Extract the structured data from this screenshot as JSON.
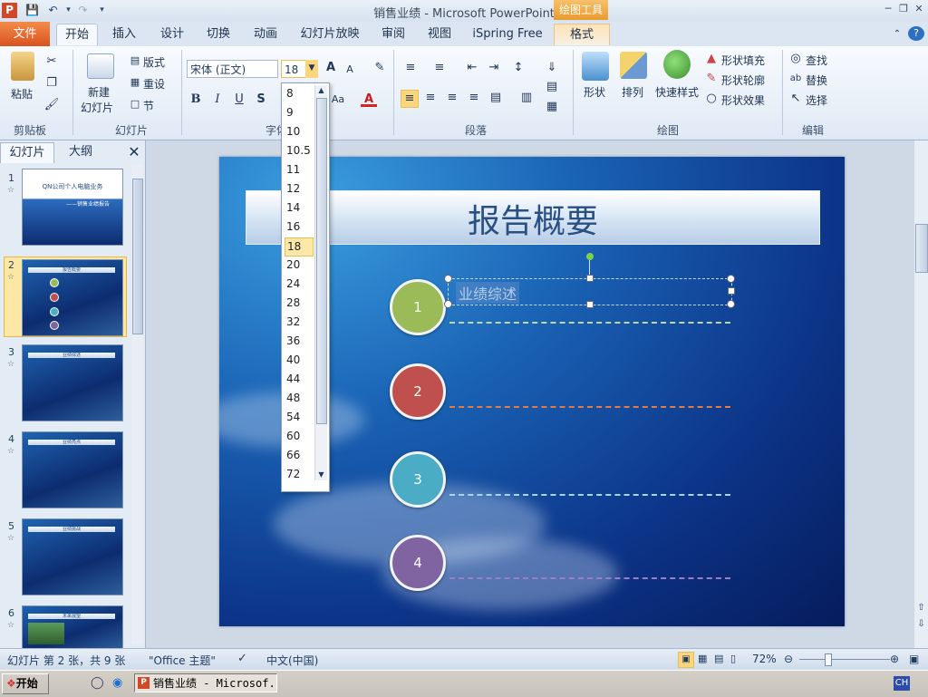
{
  "window": {
    "title": "销售业绩 - Microsoft PowerPoint",
    "context_tab_title": "绘图工具"
  },
  "tabs": [
    {
      "label": "文件"
    },
    {
      "label": "开始"
    },
    {
      "label": "插入"
    },
    {
      "label": "设计"
    },
    {
      "label": "切换"
    },
    {
      "label": "动画"
    },
    {
      "label": "幻灯片放映"
    },
    {
      "label": "审阅"
    },
    {
      "label": "视图"
    },
    {
      "label": "iSpring Free"
    },
    {
      "label": "格式"
    }
  ],
  "ribbon": {
    "clipboard": {
      "label": "剪贴板",
      "paste": "粘贴"
    },
    "slides": {
      "label": "幻灯片",
      "new_slide_1": "新建",
      "new_slide_2": "幻灯片",
      "layout": "版式",
      "reset": "重设",
      "section": "节"
    },
    "font": {
      "label": "字体",
      "font_name": "宋体 (正文)",
      "font_size": "18",
      "bold": "B",
      "italic": "I",
      "underline": "U",
      "shadow": "S"
    },
    "paragraph": {
      "label": "段落"
    },
    "drawing": {
      "label": "绘图",
      "shapes": "形状",
      "arrange": "排列",
      "quick_styles": "快速样式",
      "shape_fill": "形状填充",
      "shape_outline": "形状轮廓",
      "shape_effects": "形状效果"
    },
    "editing": {
      "label": "编辑",
      "find": "查找",
      "replace": "替换",
      "select": "选择"
    }
  },
  "font_size_options": [
    "8",
    "9",
    "10",
    "10.5",
    "11",
    "12",
    "14",
    "16",
    "18",
    "20",
    "24",
    "28",
    "32",
    "36",
    "40",
    "44",
    "48",
    "54",
    "60",
    "66",
    "72"
  ],
  "left_panel": {
    "tabs": [
      "幻灯片",
      "大纲"
    ],
    "thumbnails": [
      {
        "num": "1",
        "title": "QN公司个人电脑业务",
        "subtitle": "——销售业绩报告"
      },
      {
        "num": "2",
        "title": "报告概要"
      },
      {
        "num": "3",
        "title": "业绩综述"
      },
      {
        "num": "4",
        "title": "业绩亮点"
      },
      {
        "num": "5",
        "title": "业绩挑战"
      },
      {
        "num": "6",
        "title": "未来展望"
      }
    ]
  },
  "slide": {
    "title": "报告概要",
    "items": [
      {
        "num": "1",
        "text": "业绩综述",
        "color": "#9bbb59",
        "line_color": "#c4d79b"
      },
      {
        "num": "2",
        "text": "",
        "color": "#c0504d",
        "line_color": "#e07b4a"
      },
      {
        "num": "3",
        "text": "",
        "color": "#4bacc6",
        "line_color": "#a8d8e8"
      },
      {
        "num": "4",
        "text": "",
        "color": "#8064a2",
        "line_color": "#9b7fc4"
      }
    ]
  },
  "status": {
    "slide_info": "幻灯片 第 2 张，共 9 张",
    "theme": "\"Office 主题\"",
    "language": "中文(中国)",
    "zoom": "72%"
  },
  "taskbar": {
    "start": "开始",
    "task": "销售业绩 - Microsof...",
    "ime": "CH"
  }
}
